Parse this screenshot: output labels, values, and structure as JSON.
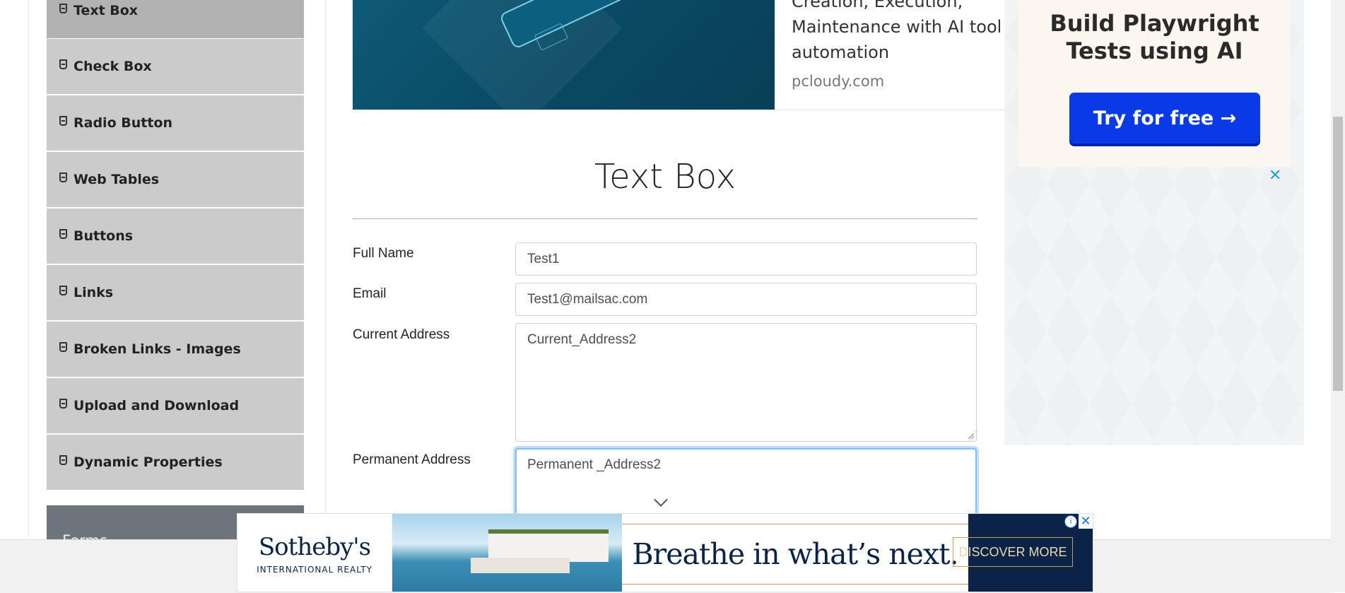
{
  "sidebar": {
    "items": [
      {
        "label": "Text Box"
      },
      {
        "label": "Check Box"
      },
      {
        "label": "Radio Button"
      },
      {
        "label": "Web Tables"
      },
      {
        "label": "Buttons"
      },
      {
        "label": "Links"
      },
      {
        "label": "Broken Links - Images"
      },
      {
        "label": "Upload and Download"
      },
      {
        "label": "Dynamic Properties"
      }
    ],
    "next_group": "Forms"
  },
  "top_ad": {
    "text": "Creation, Execution, Maintenance with AI tool fo automation",
    "line1": "Creation, Execution,",
    "line2": "Maintenance with AI tool fo",
    "line3": "automation",
    "source": "pcloudy.com"
  },
  "main": {
    "title": "Text Box",
    "form": {
      "full_name_label": "Full Name",
      "full_name_value": "Test1",
      "email_label": "Email",
      "email_value": "Test1@mailsac.com",
      "current_address_label": "Current Address",
      "current_address_value": "Current_Address2",
      "permanent_address_label": "Permanent Address",
      "permanent_address_value": "Permanent _Address2"
    }
  },
  "right_ad": {
    "title_line1": "Build Playwright",
    "title_line2": "Tests using AI",
    "cta": "Try for free →",
    "close": "✕"
  },
  "bottom_ad": {
    "brand": "Sotheby's",
    "brand_sub": "INTERNATIONAL REALTY",
    "tagline": "Breathe in what’s next.",
    "cta": "DISCOVER MORE",
    "info": "i",
    "close": "✕"
  },
  "colors": {
    "sidebar_item": "#cbcbcb",
    "sidebar_active": "#b2b2b2",
    "group_header": "#6c757d",
    "cta_blue": "#0a39e6",
    "focus_border": "#80bdff",
    "sothebys_navy": "#0b2347"
  }
}
